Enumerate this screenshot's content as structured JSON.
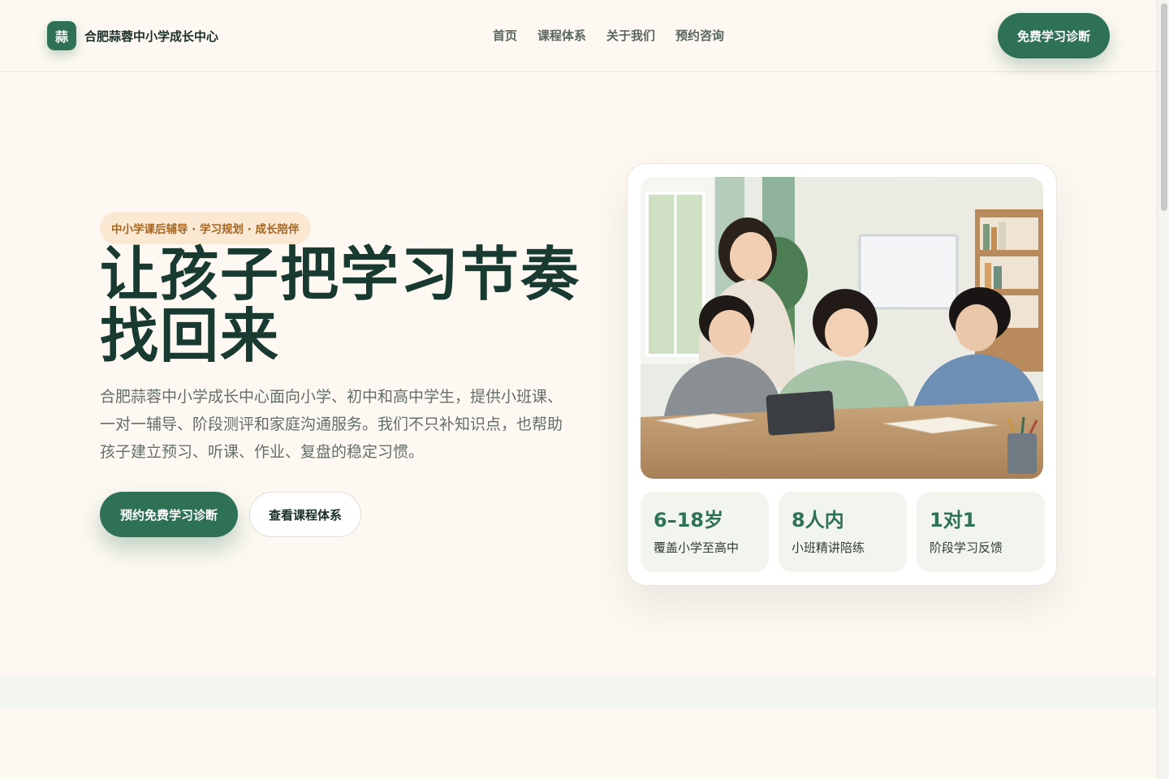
{
  "header": {
    "brand_mark": "蒜",
    "brand_name": "合肥蒜蓉中小学成长中心",
    "nav": [
      "首页",
      "课程体系",
      "关于我们",
      "预约咨询"
    ],
    "cta": "免费学习诊断"
  },
  "hero": {
    "eyebrow": "中小学课后辅导 · 学习规划 · 成长陪伴",
    "title_line1": "让孩子把学习节奏",
    "title_line2": "找回来",
    "description": "合肥蒜蓉中小学成长中心面向小学、初中和高中学生，提供小班课、一对一辅导、阶段测评和家庭沟通服务。我们不只补知识点，也帮助孩子建立预习、听课、作业、复盘的稳定习惯。",
    "primary_button": "预约免费学习诊断",
    "secondary_button": "查看课程体系"
  },
  "card": {
    "stats": [
      {
        "value": "6–18岁",
        "label": "覆盖小学至高中"
      },
      {
        "value": "8人内",
        "label": "小班精讲陪练"
      },
      {
        "value": "1对1",
        "label": "阶段学习反馈"
      }
    ]
  },
  "colors": {
    "primary": "#2f7155",
    "background": "#fdf9f2",
    "eyebrow_bg": "#fae8d3",
    "eyebrow_text": "#a56520",
    "stat_bg": "#f1f5ee"
  }
}
